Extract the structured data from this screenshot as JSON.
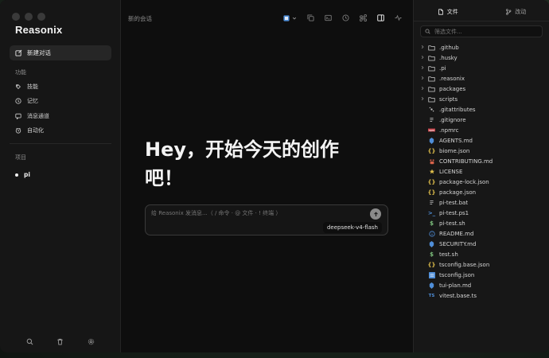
{
  "sidebar": {
    "logo": "Reasonix",
    "new_chat": "新建对话",
    "section_features": "功能",
    "features": [
      {
        "label": "技能",
        "icon": "skills-icon"
      },
      {
        "label": "记忆",
        "icon": "memory-icon"
      },
      {
        "label": "消息通道",
        "icon": "message-channel-icon"
      },
      {
        "label": "自动化",
        "icon": "automation-icon"
      }
    ],
    "section_projects": "项目",
    "projects": [
      {
        "label": "pi"
      }
    ]
  },
  "main": {
    "title": "新的会话",
    "hero_line1": "Hey，开始今天的创作",
    "hero_line2": "吧！",
    "composer_placeholder": "给 Reasonix 发消息...（ / 命令 · @ 文件 · ! 终端 ）",
    "model": "deepseek-v4-flash"
  },
  "right_panel": {
    "tab_files": "文件",
    "tab_changes": "改动",
    "filter_placeholder": "筛选文件...",
    "files": [
      {
        "name": ".github",
        "type": "folder"
      },
      {
        "name": ".husky",
        "type": "folder"
      },
      {
        "name": ".pi",
        "type": "folder"
      },
      {
        "name": ".reasonix",
        "type": "folder"
      },
      {
        "name": "packages",
        "type": "folder"
      },
      {
        "name": "scripts",
        "type": "folder"
      },
      {
        "name": ".gitattributes",
        "type": "git"
      },
      {
        "name": ".gitignore",
        "type": "text"
      },
      {
        "name": ".npmrc",
        "type": "npm"
      },
      {
        "name": "AGENTS.md",
        "type": "md"
      },
      {
        "name": "biome.json",
        "type": "json"
      },
      {
        "name": "CONTRIBUTING.md",
        "type": "contrib"
      },
      {
        "name": "LICENSE",
        "type": "license"
      },
      {
        "name": "package-lock.json",
        "type": "json"
      },
      {
        "name": "package.json",
        "type": "json"
      },
      {
        "name": "pi-test.bat",
        "type": "text"
      },
      {
        "name": "pi-test.ps1",
        "type": "ps"
      },
      {
        "name": "pi-test.sh",
        "type": "sh"
      },
      {
        "name": "README.md",
        "type": "info"
      },
      {
        "name": "SECURITY.md",
        "type": "md"
      },
      {
        "name": "test.sh",
        "type": "sh"
      },
      {
        "name": "tsconfig.base.json",
        "type": "json"
      },
      {
        "name": "tsconfig.json",
        "type": "tsconfig"
      },
      {
        "name": "tui-plan.md",
        "type": "md"
      },
      {
        "name": "vitest.base.ts",
        "type": "ts"
      }
    ]
  },
  "colors": {
    "background": "#0d0d0d",
    "sidebar": "#161616",
    "accent_json": "#e2c04b",
    "accent_md": "#4f8ed8",
    "accent_sh": "#7ec27e",
    "accent_npm": "#c8454b"
  }
}
